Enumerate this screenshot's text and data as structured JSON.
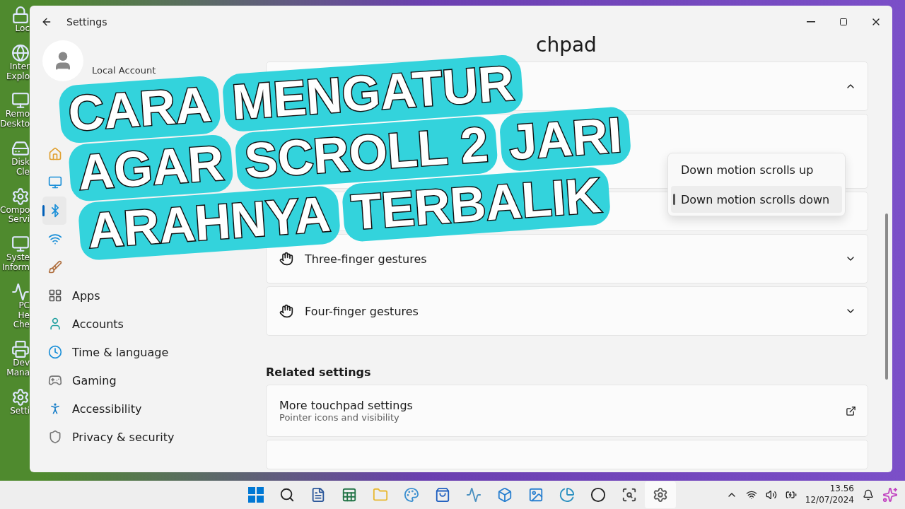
{
  "desktop_icons": [
    {
      "label": "Loc"
    },
    {
      "label": "Inter Explo"
    },
    {
      "label": "Remo Deskto"
    },
    {
      "label": "Disk Cle"
    },
    {
      "label": "Compo Servi"
    },
    {
      "label": "Syste Inform"
    },
    {
      "label": "PC He Che"
    },
    {
      "label": "Dev Mana"
    },
    {
      "label": "Setti"
    }
  ],
  "window": {
    "title": "Settings"
  },
  "account": {
    "subtitle": "Local Account"
  },
  "sidebar": {
    "items": [
      {
        "selected": false
      },
      {
        "selected": false
      },
      {
        "selected": true
      },
      {
        "selected": false
      },
      {
        "selected": false
      },
      {
        "label": "Apps",
        "selected": false
      },
      {
        "label": "Accounts",
        "selected": false
      },
      {
        "label": "Time & language",
        "selected": false
      },
      {
        "label": "Gaming",
        "selected": false
      },
      {
        "label": "Accessibility",
        "selected": false
      },
      {
        "label": "Privacy & security",
        "selected": false
      }
    ]
  },
  "heading": {
    "visible_part": "chpad"
  },
  "scroll_card": {
    "expanded": true
  },
  "direction_menu": {
    "options": [
      {
        "label": "Down motion scrolls up",
        "selected": false
      },
      {
        "label": "Down motion scrolls down",
        "selected": true
      }
    ]
  },
  "gestures": [
    {
      "label": "Three-finger gestures",
      "expanded": false
    },
    {
      "label": "Four-finger gestures",
      "expanded": false
    }
  ],
  "related": {
    "title": "Related settings",
    "items": [
      {
        "title": "More touchpad settings",
        "subtitle": "Pointer icons and visibility"
      }
    ]
  },
  "banner": {
    "lines": [
      [
        "CARA",
        "MENGATUR"
      ],
      [
        "AGAR",
        "SCROLL 2",
        "JARI"
      ],
      [
        "ARAHNYA",
        "TERBALIK"
      ]
    ]
  },
  "taskbar": {
    "time": "13.56",
    "date": "12/07/2024"
  }
}
